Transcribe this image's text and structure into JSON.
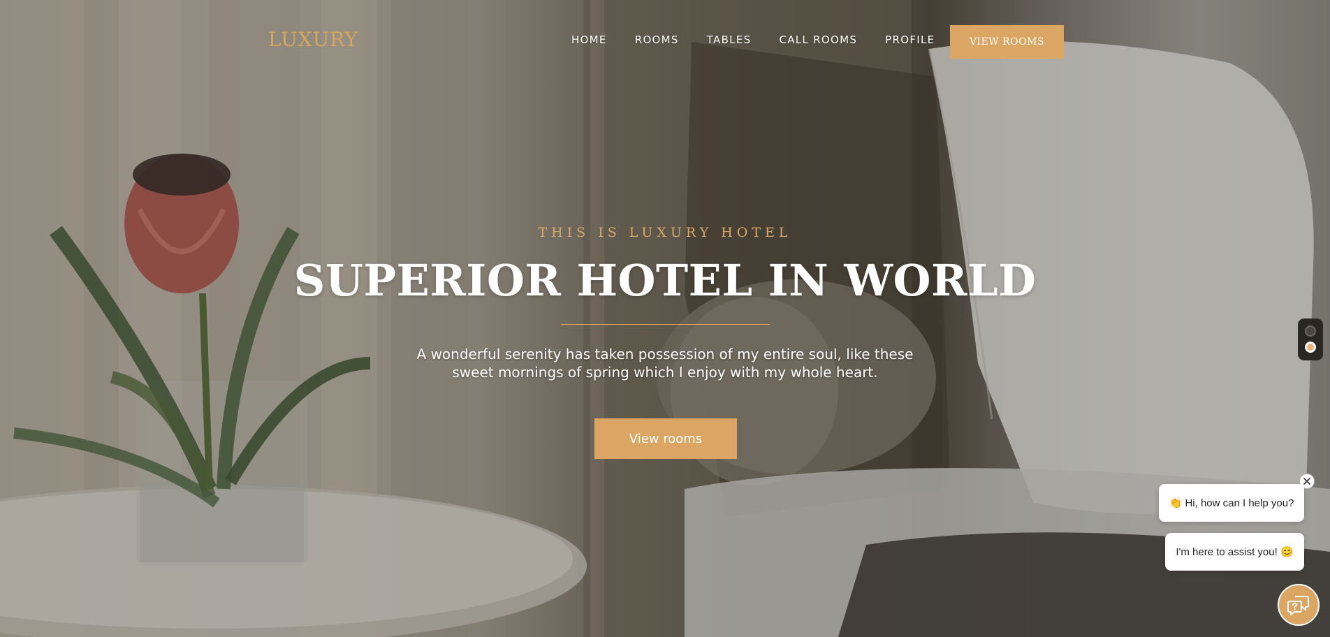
{
  "brand": {
    "logo": "LUXURY"
  },
  "nav": {
    "items": [
      {
        "label": "HOME"
      },
      {
        "label": "ROOMS"
      },
      {
        "label": "TABLES"
      },
      {
        "label": "CALL ROOMS"
      },
      {
        "label": "PROFILE"
      }
    ],
    "cta_label": "VIEW ROOMS"
  },
  "hero": {
    "eyebrow": "THIS IS LUXURY HOTEL",
    "headline": "SUPERIOR HOTEL IN WORLD",
    "lead": "A wonderful serenity has taken possession of my entire soul, like these sweet mornings of spring which I enjoy with my whole heart.",
    "cta_label": "View rooms"
  },
  "chat": {
    "bubble_1": "👏 Hi, how can I help you?",
    "bubble_2": "I'm here to assist you! 😊",
    "close_icon": "close-icon",
    "fab_icon": "chat-help-icon"
  },
  "colors": {
    "accent": "#dba563",
    "logo": "#d7a65d",
    "text_light": "#ffffff"
  }
}
